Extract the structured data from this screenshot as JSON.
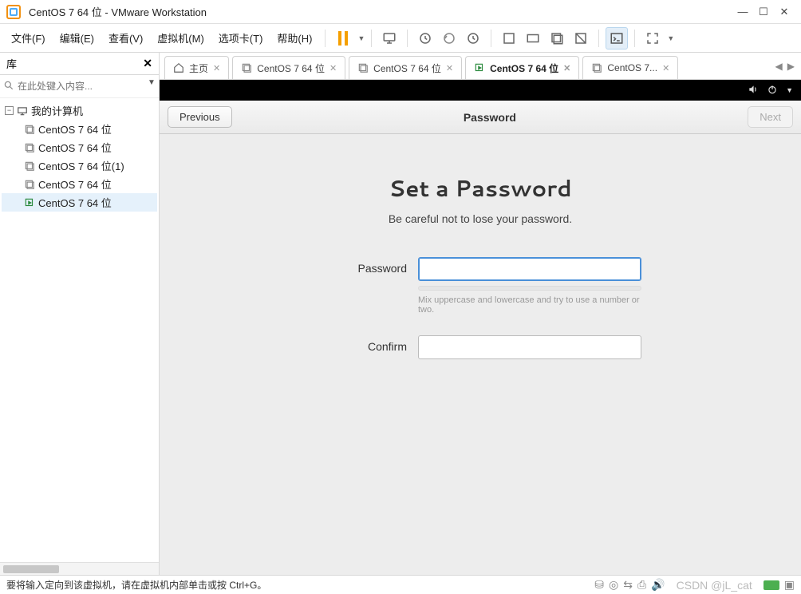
{
  "window": {
    "title": "CentOS 7 64 位 - VMware Workstation"
  },
  "menu": {
    "file": "文件(F)",
    "edit": "编辑(E)",
    "view": "查看(V)",
    "vm": "虚拟机(M)",
    "tabs": "选项卡(T)",
    "help": "帮助(H)"
  },
  "sidebar": {
    "title": "库",
    "search_placeholder": "在此处键入内容...",
    "root": "我的计算机",
    "items": [
      {
        "label": "CentOS 7 64 位",
        "running": false
      },
      {
        "label": "CentOS 7 64 位",
        "running": false
      },
      {
        "label": "CentOS 7 64 位(1)",
        "running": false
      },
      {
        "label": "CentOS 7 64 位",
        "running": false
      },
      {
        "label": "CentOS 7 64 位",
        "running": true
      }
    ]
  },
  "tabs": [
    {
      "label": "主页",
      "kind": "home"
    },
    {
      "label": "CentOS 7 64 位",
      "kind": "vm"
    },
    {
      "label": "CentOS 7 64 位",
      "kind": "vm"
    },
    {
      "label": "CentOS 7 64 位",
      "kind": "vm",
      "active": true
    },
    {
      "label": "CentOS 7...",
      "kind": "vm"
    }
  ],
  "gnome": {
    "prev": "Previous",
    "next": "Next",
    "header_title": "Password",
    "heading": "Set a Password",
    "subtitle": "Be careful not to lose your password.",
    "password_label": "Password",
    "confirm_label": "Confirm",
    "hint": "Mix uppercase and lowercase and try to use a number or two.",
    "password_value": "",
    "confirm_value": ""
  },
  "status": {
    "text": "要将输入定向到该虚拟机，请在虚拟机内部单击或按 Ctrl+G。",
    "watermark": "CSDN @jL_cat"
  }
}
